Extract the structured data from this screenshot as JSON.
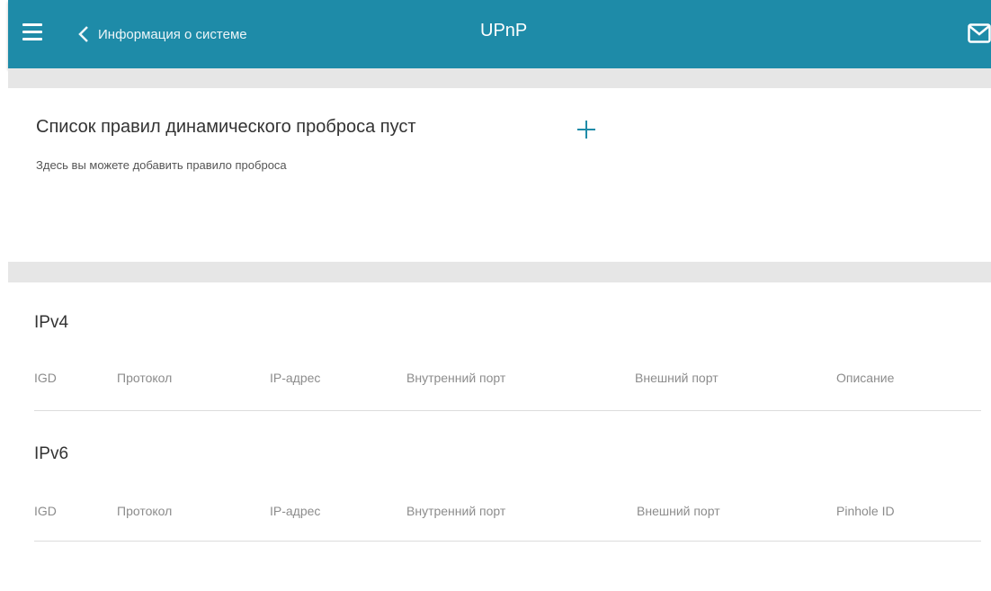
{
  "header": {
    "back_label": "Информация о системе",
    "title": "UPnP",
    "accent_color": "#1e8ba8"
  },
  "icons": {
    "menu": "hamburger-icon",
    "back": "chevron-left-icon",
    "mail": "envelope-icon",
    "add": "plus-icon"
  },
  "rules": {
    "title": "Список правил динамического проброса пуст",
    "subtitle": "Здесь вы можете добавить правило проброса"
  },
  "ipv4": {
    "title": "IPv4",
    "columns": [
      "IGD",
      "Протокол",
      "IP-адрес",
      "Внутренний порт",
      "Внешний порт",
      "Описание"
    ]
  },
  "ipv6": {
    "title": "IPv6",
    "columns": [
      "IGD",
      "Протокол",
      "IP-адрес",
      "Внутренний порт",
      "Внешний порт",
      "Pinhole ID"
    ]
  }
}
